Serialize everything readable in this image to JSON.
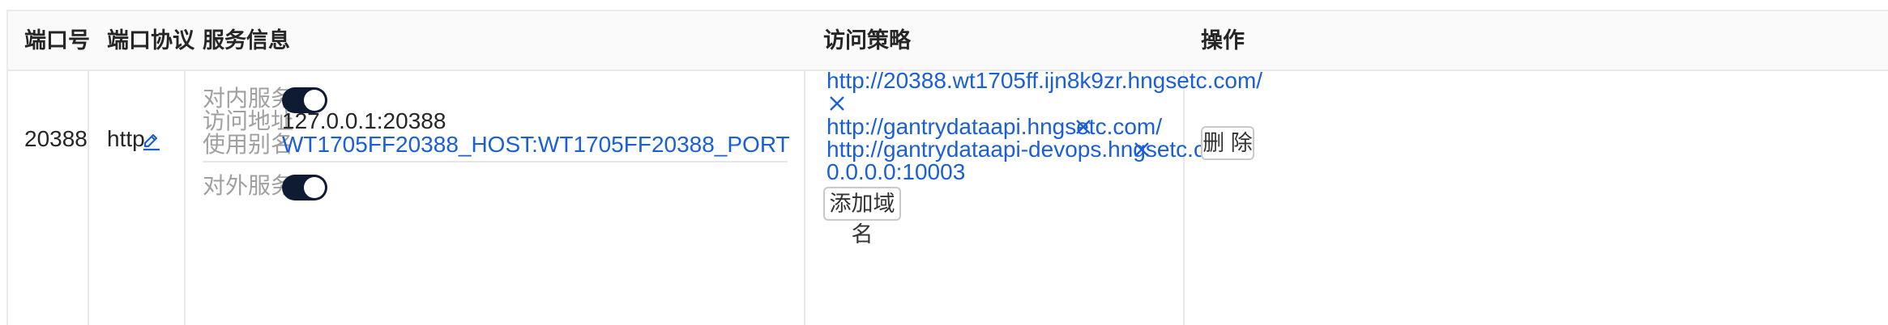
{
  "columns": {
    "port": "端口号",
    "protocol": "端口协议",
    "service_info": "服务信息",
    "access_policy": "访问策略",
    "operation": "操作"
  },
  "row": {
    "port": "20388",
    "protocol": "http",
    "internal": {
      "label": "对内服务",
      "enabled": true,
      "address_label": "访问地址",
      "address": "127.0.0.1:20388",
      "alias_label": "使用别名",
      "alias": "WT1705FF20388_HOST:WT1705FF20388_PORT"
    },
    "external": {
      "label": "对外服务",
      "enabled": true
    },
    "domains": [
      "http://20388.wt1705ff.ijn8k9zr.hngsetc.com/",
      "http://gantrydataapi.hngsetc.com/",
      "http://gantrydataapi-devops.hngsetc.com/"
    ],
    "bind_address": "0.0.0.0:10003",
    "add_domain_label": "添加域名",
    "delete_label": "删 除"
  },
  "colors": {
    "link": "#1a5fd6",
    "toggle_on": "#0f1a33",
    "header_bg": "#fafafa"
  },
  "icons": {
    "edit": "pencil-underline",
    "remove": "x"
  }
}
